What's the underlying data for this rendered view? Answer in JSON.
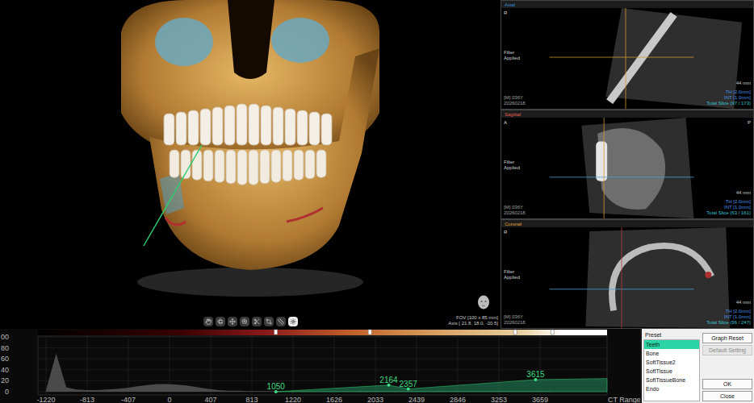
{
  "viewer3d": {
    "fov": "FOV [100 x 85 mm]",
    "axis": "Axis [ 21.8, 18.0, -20.5]",
    "tools": [
      {
        "selected": false
      },
      {
        "selected": false
      },
      {
        "selected": false
      },
      {
        "selected": false
      },
      {
        "selected": false
      },
      {
        "selected": false
      },
      {
        "selected": false
      },
      {
        "selected": true
      }
    ]
  },
  "views": [
    {
      "name": "Axial",
      "kind": "axial",
      "color": "#3a8fd8",
      "orientation_left": "R",
      "orientation_right": "",
      "filter": [
        "Filter",
        "Applied"
      ],
      "scale": "44 mm",
      "patient": [
        "[M] 036Y",
        "20260218"
      ],
      "info": [
        "TH [2.0mm]",
        "INT [1.0mm]",
        "Total Slice (97 / 173)"
      ]
    },
    {
      "name": "Sagittal",
      "kind": "sagittal",
      "color": "#e05a4f",
      "orientation_left": "A",
      "orientation_right": "P",
      "filter": [
        "Filter",
        "Applied"
      ],
      "scale": "44 mm",
      "patient": [
        "[M] 036Y",
        "20260218"
      ],
      "info": [
        "TH [2.0mm]",
        "INT [1.0mm]",
        "Total Slice (63 / 161)"
      ]
    },
    {
      "name": "Coronal",
      "kind": "coronal",
      "color": "#e0a030",
      "orientation_left": "R",
      "orientation_right": "",
      "filter": [
        "Filter",
        "Applied"
      ],
      "scale": "44 mm",
      "patient": [
        "[M] 036Y",
        "20260218"
      ],
      "info": [
        "TH [2.0mm]",
        "INT [1.0mm]",
        "Total Slice (96 / 247)"
      ]
    }
  ],
  "chart": {
    "y_ticks": [
      "00",
      "80",
      "60",
      "40",
      "20",
      "0"
    ],
    "y_range": [
      0,
      100
    ],
    "x_ticks": [
      "-1220",
      "-813",
      "-407",
      "0",
      "407",
      "813",
      "1220",
      "1626",
      "2033",
      "2439",
      "2846",
      "3253",
      "3659"
    ],
    "x_title": "CT Range",
    "histogram": {
      "start": -1220,
      "step": 100,
      "values": [
        3,
        70,
        8,
        4,
        3,
        3,
        4,
        5,
        7,
        10,
        12,
        14,
        14,
        13,
        11,
        8,
        5,
        3,
        2,
        2,
        1,
        1,
        1,
        1,
        1,
        1,
        1,
        1,
        1,
        1,
        1,
        1,
        1,
        1,
        1,
        1,
        1,
        1,
        1,
        1,
        1,
        1,
        1,
        1,
        1,
        1,
        1,
        1,
        1,
        1,
        1
      ]
    },
    "curve": [
      [
        1050,
        0
      ],
      [
        2164,
        12
      ],
      [
        2357,
        5
      ],
      [
        3615,
        22
      ],
      [
        4320,
        24
      ]
    ],
    "points": [
      {
        "label": "1050",
        "x": 1050,
        "y": 0
      },
      {
        "label": "2164",
        "x": 2164,
        "y": 12
      },
      {
        "label": "2357",
        "x": 2357,
        "y": 5
      },
      {
        "label": "3615",
        "x": 3615,
        "y": 22
      }
    ],
    "color_stops": [
      1050,
      1978,
      3413,
      3780
    ]
  },
  "preset": {
    "label": "Preset",
    "items": [
      {
        "label": "Teeth",
        "selected": true
      },
      {
        "label": "Bone",
        "selected": false
      },
      {
        "label": "SoftTissue2",
        "selected": false
      },
      {
        "label": "SoftTissue",
        "selected": false
      },
      {
        "label": "SoftTissueBone",
        "selected": false
      },
      {
        "label": "Endo",
        "selected": false
      }
    ],
    "actions": [
      {
        "label": "Graph Reset",
        "disabled": false
      },
      {
        "label": "Default Setting",
        "disabled": true
      }
    ],
    "buttons": [
      {
        "label": "OK"
      },
      {
        "label": "Close"
      }
    ]
  }
}
